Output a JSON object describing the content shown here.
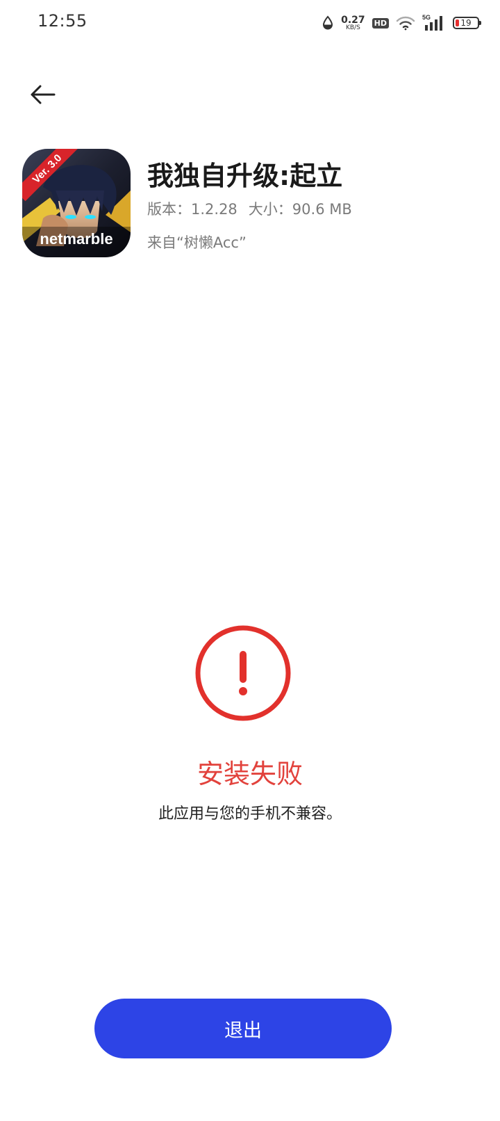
{
  "status_bar": {
    "time": "12:55",
    "net_speed_value": "0.27",
    "net_speed_unit": "KB/S",
    "hd_label": "HD",
    "network_type": "5G",
    "battery_level": "19",
    "battery_color": "#e52e2e"
  },
  "app": {
    "name": "我独自升级:起立",
    "version": "版本：1.2.28",
    "size": "大小：90.6 MB",
    "source": "来自“树懒Acc”",
    "icon_badge": "Ver. 3.0",
    "icon_brand": "netmarble"
  },
  "result": {
    "title": "安装失败",
    "message": "此应用与您的手机不兼容。",
    "error_color": "#e2423c"
  },
  "actions": {
    "exit_label": "退出",
    "button_color": "#2d44e6"
  },
  "icons": {
    "back": "back-arrow-icon",
    "error": "error-exclamation-icon",
    "data_saver": "data-saver-icon",
    "wifi": "wifi-icon",
    "signal": "signal-icon",
    "battery": "battery-icon"
  }
}
